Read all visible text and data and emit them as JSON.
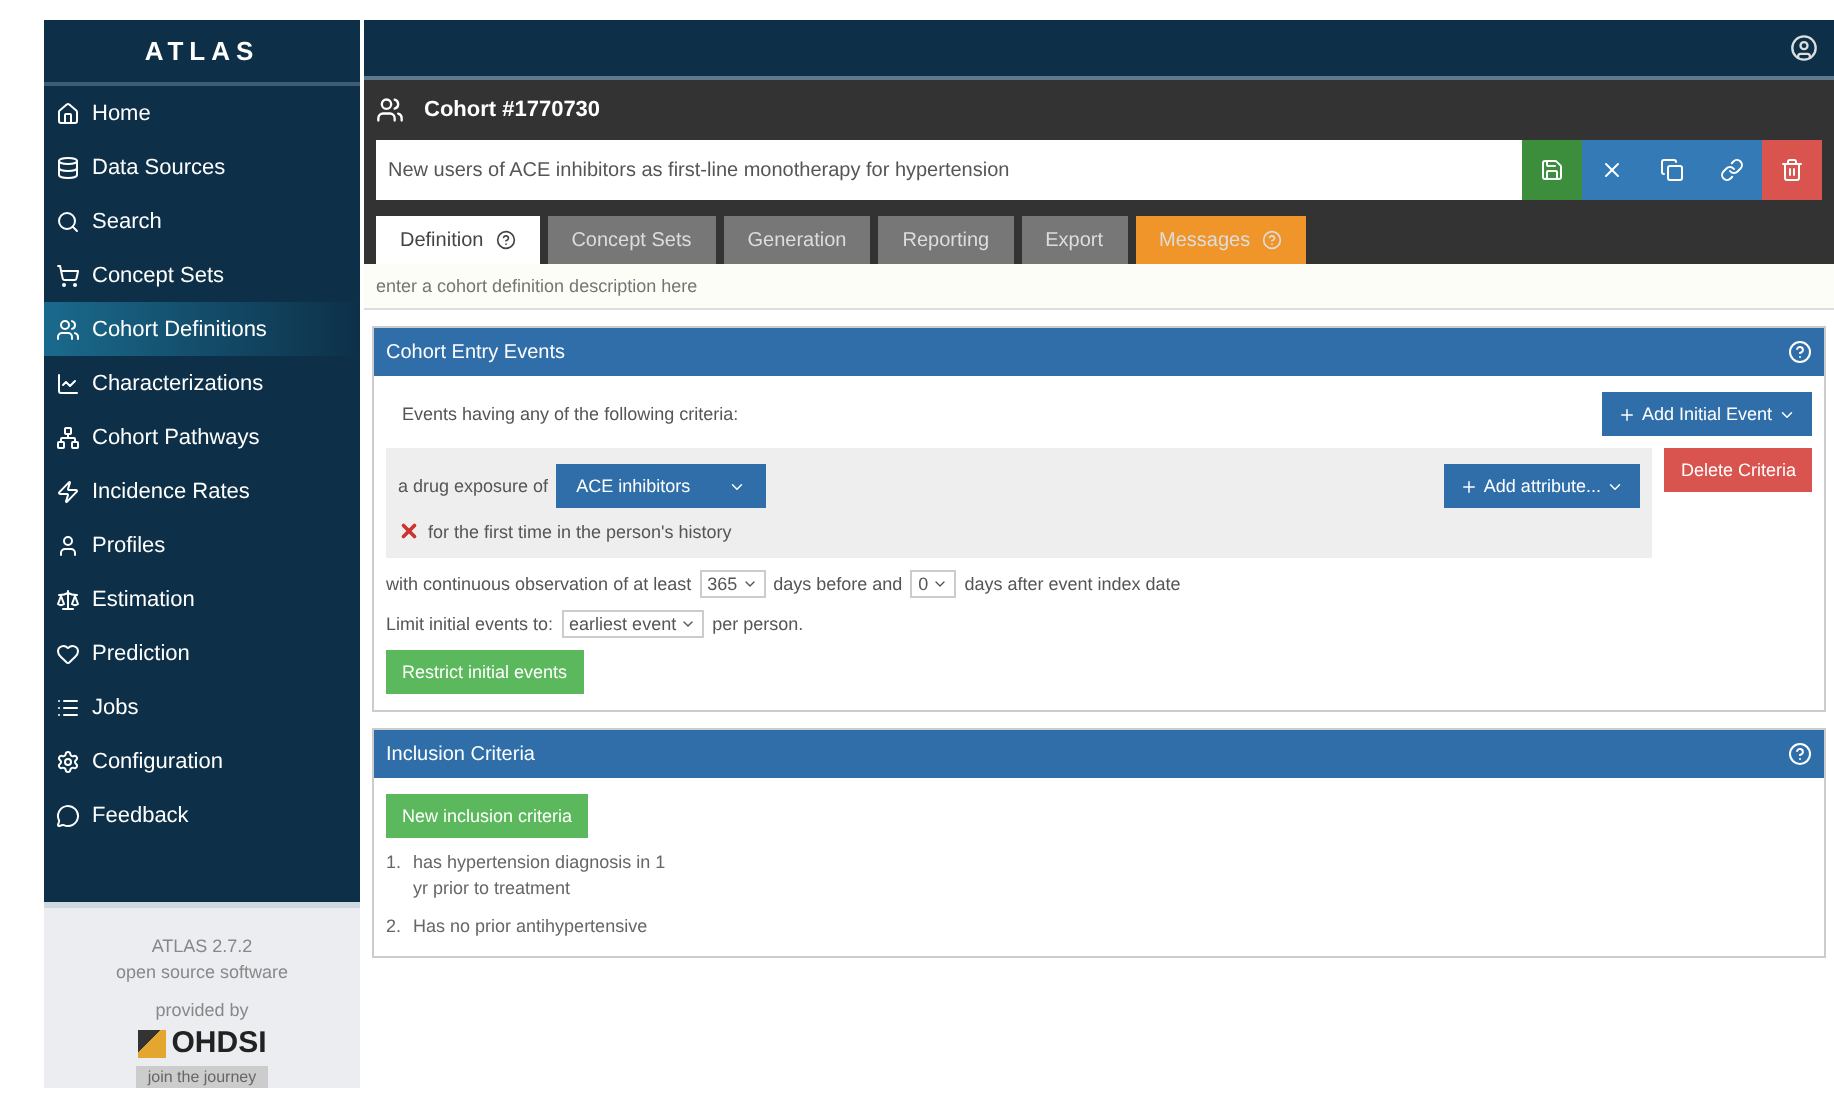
{
  "app": {
    "title": "ATLAS"
  },
  "sidebar": {
    "items": [
      {
        "label": "Home",
        "selected": false
      },
      {
        "label": "Data Sources",
        "selected": false
      },
      {
        "label": "Search",
        "selected": false
      },
      {
        "label": "Concept Sets",
        "selected": false
      },
      {
        "label": "Cohort Definitions",
        "selected": true
      },
      {
        "label": "Characterizations",
        "selected": false
      },
      {
        "label": "Cohort Pathways",
        "selected": false
      },
      {
        "label": "Incidence Rates",
        "selected": false
      },
      {
        "label": "Profiles",
        "selected": false
      },
      {
        "label": "Estimation",
        "selected": false
      },
      {
        "label": "Prediction",
        "selected": false
      },
      {
        "label": "Jobs",
        "selected": false
      },
      {
        "label": "Configuration",
        "selected": false
      },
      {
        "label": "Feedback",
        "selected": false
      }
    ],
    "footer": {
      "version": "ATLAS 2.7.2",
      "tagline": "open source software",
      "provided": "provided by",
      "brand": "OHDSI",
      "link": "join the journey"
    }
  },
  "header": {
    "title": "Cohort #1770730",
    "name": "New users of ACE inhibitors as first-line monotherapy for hypertension"
  },
  "toolbar": [
    {
      "kind": "save",
      "color": "#3c8d3c"
    },
    {
      "kind": "close",
      "color": "#337ab7"
    },
    {
      "kind": "copy",
      "color": "#337ab7"
    },
    {
      "kind": "link",
      "color": "#337ab7"
    },
    {
      "kind": "delete",
      "color": "#d9534f"
    }
  ],
  "tabs": [
    {
      "label": "Definition",
      "selected": true,
      "kind": "normal"
    },
    {
      "label": "Concept Sets",
      "selected": false,
      "kind": "normal"
    },
    {
      "label": "Generation",
      "selected": false,
      "kind": "normal"
    },
    {
      "label": "Reporting",
      "selected": false,
      "kind": "normal"
    },
    {
      "label": "Export",
      "selected": false,
      "kind": "normal"
    },
    {
      "label": "Messages",
      "selected": false,
      "kind": "warning"
    }
  ],
  "description": {
    "placeholder": "enter a cohort definition description here"
  },
  "entry": {
    "title": "Cohort Entry Events",
    "intro": "Events having any of the following criteria:",
    "add_button": "Add Initial Event",
    "criteria": {
      "prefix": "a drug exposure of",
      "concept": "ACE inhibitors",
      "attribute_button": "Add attribute...",
      "delete_button": "Delete Criteria",
      "first_time": "for the first time in the person's history"
    },
    "observation": {
      "before": "with continuous observation of at least",
      "days_before": "365",
      "middle": "days before and",
      "days_after": "0",
      "after": "days after event index date"
    },
    "limit": {
      "before": "Limit initial events to:",
      "value": "earliest event",
      "after": "per person."
    },
    "restrict_button": "Restrict initial events"
  },
  "inclusion": {
    "title": "Inclusion Criteria",
    "new_button": "New inclusion criteria",
    "rules": [
      {
        "number": "1.",
        "lines": [
          "has hypertension diagnosis in 1",
          "yr prior to treatment"
        ]
      },
      {
        "number": "2.",
        "lines": [
          "Has no prior antihypertensive"
        ]
      }
    ]
  }
}
